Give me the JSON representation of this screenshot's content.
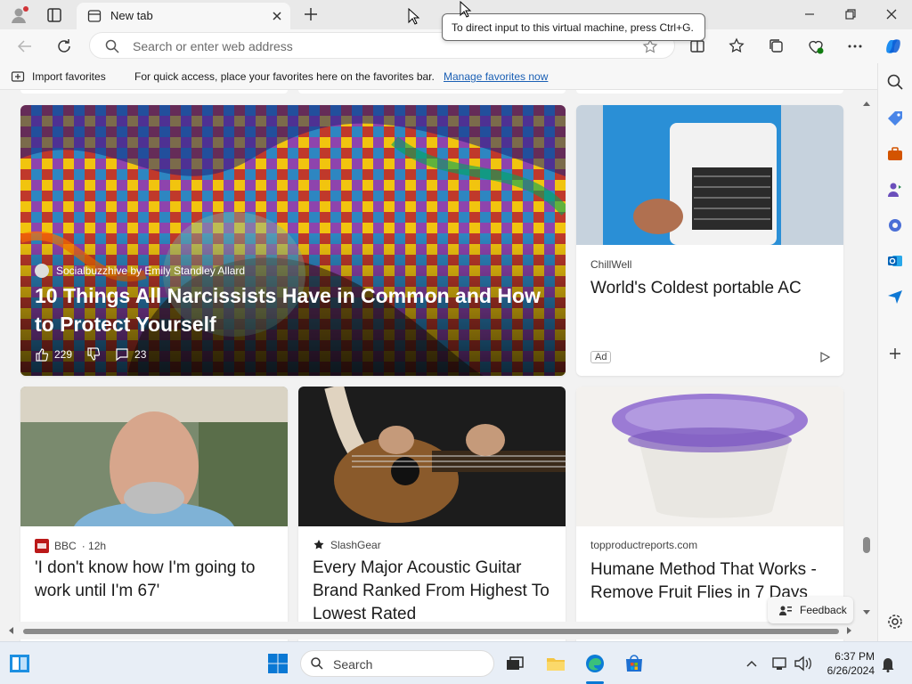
{
  "tab": {
    "title": "New tab"
  },
  "address": {
    "placeholder": "Search or enter web address"
  },
  "tooltip": {
    "text": "To direct input to this virtual machine, press Ctrl+G."
  },
  "favorites": {
    "import_label": "Import favorites",
    "message": "For quick access, place your favorites here on the favorites bar.",
    "manage_link": "Manage favorites now"
  },
  "hero": {
    "source": "Socialbuzzhive by Emily Standley Allard",
    "title": "10 Things All Narcissists Have in Common and How to Protect Yourself",
    "likes": "229",
    "comments": "23"
  },
  "ad_card": {
    "source": "ChillWell",
    "title": "World's Coldest portable AC",
    "ad_label": "Ad"
  },
  "cards": [
    {
      "source": "BBC",
      "age": "· 12h",
      "title": "'I don't know how I'm going to work until I'm 67'"
    },
    {
      "source": "SlashGear",
      "title": "Every Major Acoustic Guitar Brand Ranked From Highest To Lowest Rated"
    },
    {
      "source": "topproductreports.com",
      "title": "Humane Method That Works - Remove Fruit Flies in 7 Days"
    }
  ],
  "feedback": {
    "label": "Feedback"
  },
  "taskbar": {
    "search_label": "Search",
    "time": "6:37 PM",
    "date": "6/26/2024"
  }
}
